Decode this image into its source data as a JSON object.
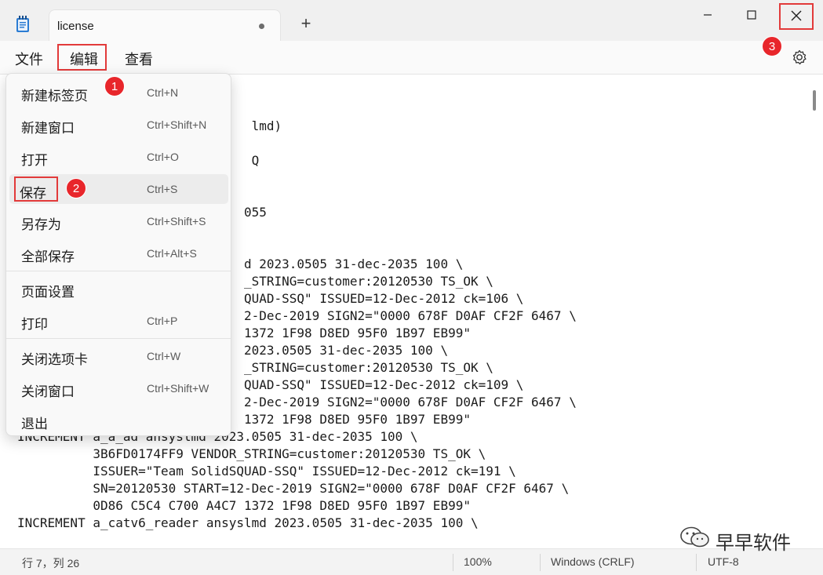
{
  "window": {
    "tab_title": "license",
    "new_tab": "+",
    "app_icon": "notepad-icon",
    "colors": {
      "highlight": "#e23a3a",
      "badge": "#e8262b"
    }
  },
  "menubar": {
    "file": "文件",
    "edit": "编辑",
    "view": "查看",
    "settings_icon": "gear-icon"
  },
  "dropdown": {
    "items": [
      {
        "label": "新建标签页",
        "shortcut": "Ctrl+N"
      },
      {
        "label": "新建窗口",
        "shortcut": "Ctrl+Shift+N"
      },
      {
        "label": "打开",
        "shortcut": "Ctrl+O"
      },
      {
        "label": "保存",
        "shortcut": "Ctrl+S"
      },
      {
        "label": "另存为",
        "shortcut": "Ctrl+Shift+S"
      },
      {
        "label": "全部保存",
        "shortcut": "Ctrl+Alt+S"
      },
      {
        "label": "页面设置",
        "shortcut": ""
      },
      {
        "label": "打印",
        "shortcut": "Ctrl+P"
      },
      {
        "label": "关闭选项卡",
        "shortcut": "Ctrl+W"
      },
      {
        "label": "关闭窗口",
        "shortcut": "Ctrl+Shift+W"
      },
      {
        "label": "退出",
        "shortcut": ""
      }
    ]
  },
  "callouts": [
    "1",
    "2",
    "3"
  ],
  "editor": {
    "lines": [
      "",
      "                               lmd)",
      "",
      "                               Q",
      "",
      "",
      "                              055",
      "",
      "",
      "                              d 2023.0505 31-dec-2035 100 \\",
      "                              _STRING=customer:20120530 TS_OK \\",
      "                              QUAD-SSQ\" ISSUED=12-Dec-2012 ck=106 \\",
      "                              2-Dec-2019 SIGN2=\"0000 678F D0AF CF2F 6467 \\",
      "                              1372 1F98 D8ED 95F0 1B97 EB99\"",
      "                              2023.0505 31-dec-2035 100 \\",
      "                              _STRING=customer:20120530 TS_OK \\",
      "                              QUAD-SSQ\" ISSUED=12-Dec-2012 ck=109 \\",
      "                              2-Dec-2019 SIGN2=\"0000 678F D0AF CF2F 6467 \\",
      "                              1372 1F98 D8ED 95F0 1B97 EB99\"",
      "INCREMENT a_a_ad ansyslmd 2023.0505 31-dec-2035 100 \\",
      "          3B6FD0174FF9 VENDOR_STRING=customer:20120530 TS_OK \\",
      "          ISSUER=\"Team SolidSQUAD-SSQ\" ISSUED=12-Dec-2012 ck=191 \\",
      "          SN=20120530 START=12-Dec-2019 SIGN2=\"0000 678F D0AF CF2F 6467 \\",
      "          0D86 C5C4 C700 A4C7 1372 1F98 D8ED 95F0 1B97 EB99\"",
      "INCREMENT a_catv6_reader ansyslmd 2023.0505 31-dec-2035 100 \\"
    ]
  },
  "status": {
    "position": "行 7，列 26",
    "zoom": "100%",
    "line_ending": "Windows (CRLF)",
    "encoding": "UTF-8"
  },
  "watermark": {
    "text": "早早软件",
    "icon": "wechat-icon"
  }
}
